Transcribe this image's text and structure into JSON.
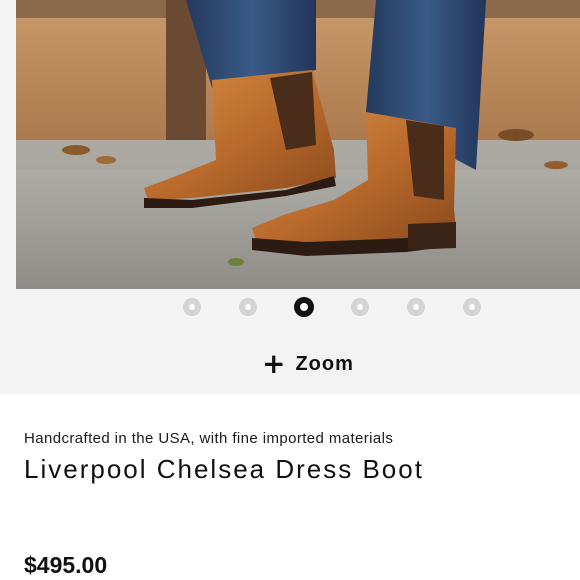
{
  "gallery": {
    "image_alt_icon": "boot-photo",
    "dots_count": 6,
    "active_index": 2,
    "zoom_icon": "plus-icon",
    "zoom_label": "Zoom"
  },
  "product": {
    "subtitle": "Handcrafted in the USA, with fine imported materials",
    "name": "Liverpool Chelsea Dress Boot",
    "price": "$495.00"
  },
  "colors": {
    "leather": "#b9692a",
    "denim": "#2f4a73",
    "panel": "#f3f3f3"
  }
}
